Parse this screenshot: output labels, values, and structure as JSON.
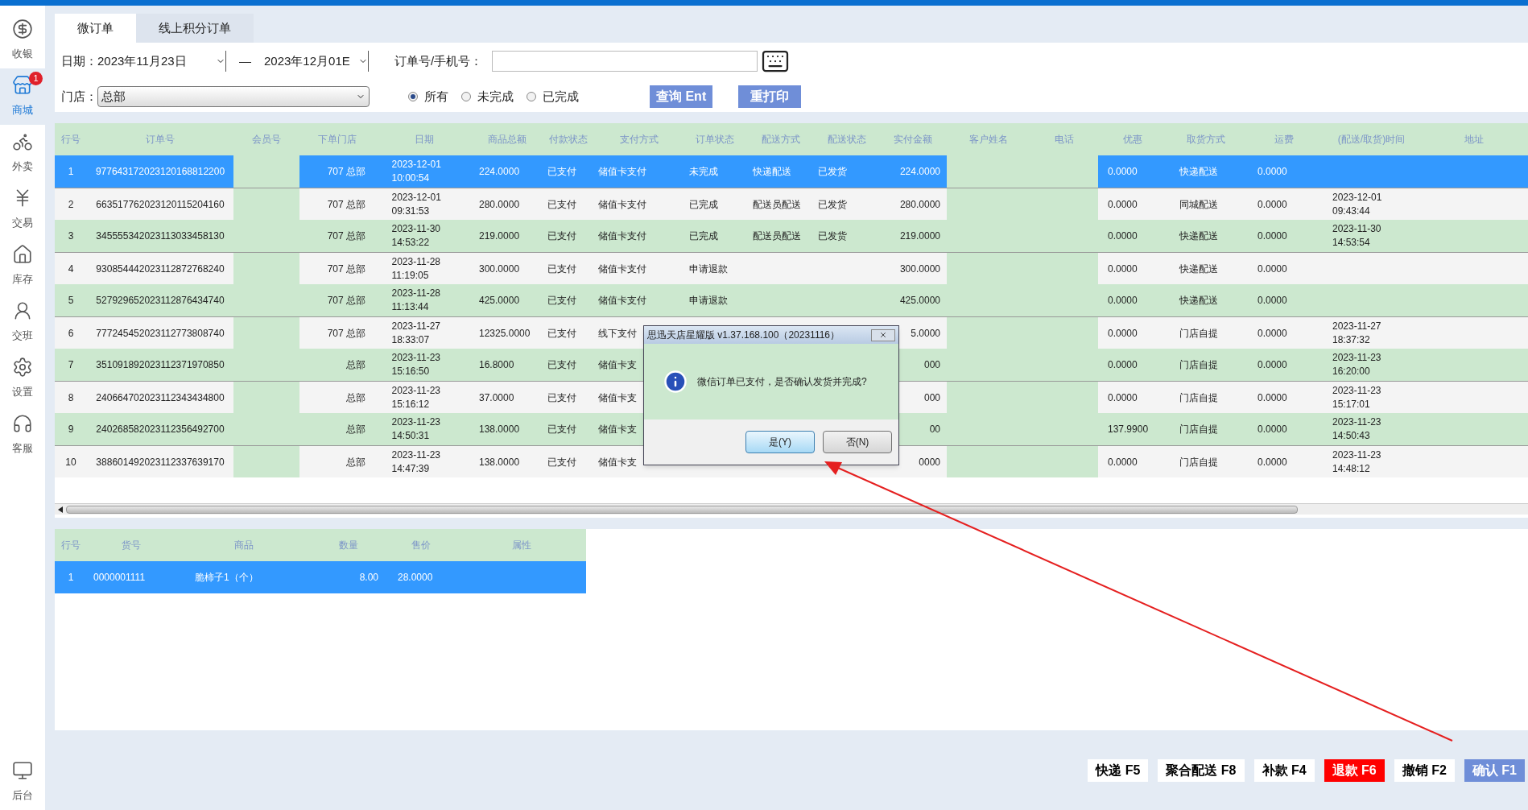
{
  "sidebar": {
    "items": [
      {
        "label": "收银",
        "selected": false
      },
      {
        "label": "商城",
        "selected": true,
        "badge": "1"
      },
      {
        "label": "外卖",
        "selected": false
      },
      {
        "label": "交易",
        "selected": false
      },
      {
        "label": "库存",
        "selected": false
      },
      {
        "label": "交班",
        "selected": false
      },
      {
        "label": "设置",
        "selected": false
      },
      {
        "label": "客服",
        "selected": false
      },
      {
        "label": "后台",
        "selected": false
      }
    ]
  },
  "tabs": [
    {
      "label": "微订单",
      "selected": true
    },
    {
      "label": "线上积分订单",
      "selected": false
    }
  ],
  "filters": {
    "date_label": "日期：",
    "date_from": "2023年11月23日",
    "separator": "—",
    "date_to": "2023年12月01E",
    "order_label": "订单号/手机号：",
    "store_label": "门店：",
    "store": "总部",
    "status_options": [
      {
        "label": "所有",
        "selected": true
      },
      {
        "label": "未完成",
        "selected": false
      },
      {
        "label": "已完成",
        "selected": false
      }
    ],
    "buttons": [
      "查询 Ent",
      "重打印"
    ]
  },
  "orders": {
    "columns": [
      "行号",
      "订单号",
      "会员号",
      "下单门店",
      "日期",
      "商品总额",
      "付款状态",
      "支付方式",
      "订单状态",
      "配送方式",
      "配送状态",
      "实付金额",
      "客户姓名",
      "电话",
      "优惠",
      "取货方式",
      "运费",
      "(配送/取货)时间",
      "地址"
    ],
    "rows": [
      {
        "selected": true,
        "row_no": "1",
        "order_no": "977643172023120168812200",
        "store": "707 总部",
        "date": "2023-12-01 10:00:54",
        "goods_total": "224.0000",
        "pay_status": "已支付",
        "pay_method": "储值卡支付",
        "order_status": "未完成",
        "delivery_method": "快递配送",
        "delivery_status": "已发货",
        "paid_amount": "224.0000",
        "discount": "0.0000",
        "pickup_method": "快递配送",
        "freight": "0.0000"
      },
      {
        "selected": false,
        "row_no": "2",
        "order_no": "663517762023120115204160",
        "store": "707 总部",
        "date": "2023-12-01 09:31:53",
        "goods_total": "280.0000",
        "pay_status": "已支付",
        "pay_method": "储值卡支付",
        "order_status": "已完成",
        "delivery_method": "配送员配送",
        "delivery_status": "已发货",
        "paid_amount": "280.0000",
        "discount": "0.0000",
        "pickup_method": "同城配送",
        "freight": "0.0000",
        "time": "2023-12-01 09:43:44"
      },
      {
        "selected": false,
        "row_no": "3",
        "order_no": "345555342023113033458130",
        "store": "707 总部",
        "date": "2023-11-30 14:53:22",
        "goods_total": "219.0000",
        "pay_status": "已支付",
        "pay_method": "储值卡支付",
        "order_status": "已完成",
        "delivery_method": "配送员配送",
        "delivery_status": "已发货",
        "paid_amount": "219.0000",
        "discount": "0.0000",
        "pickup_method": "快递配送",
        "freight": "0.0000",
        "time": "2023-11-30 14:53:54"
      },
      {
        "selected": false,
        "row_no": "4",
        "order_no": "930854442023112872768240",
        "store": "707 总部",
        "date": "2023-11-28 11:19:05",
        "goods_total": "300.0000",
        "pay_status": "已支付",
        "pay_method": "储值卡支付",
        "order_status": "申请退款",
        "paid_amount": "300.0000",
        "discount": "0.0000",
        "pickup_method": "快递配送",
        "freight": "0.0000"
      },
      {
        "selected": false,
        "row_no": "5",
        "order_no": "527929652023112876434740",
        "store": "707 总部",
        "date": "2023-11-28 11:13:44",
        "goods_total": "425.0000",
        "pay_status": "已支付",
        "pay_method": "储值卡支付",
        "order_status": "申请退款",
        "paid_amount": "425.0000",
        "discount": "0.0000",
        "pickup_method": "快递配送",
        "freight": "0.0000"
      },
      {
        "selected": false,
        "row_no": "6",
        "order_no": "777245452023112773808740",
        "store": "707 总部",
        "date": "2023-11-27 18:33:07",
        "goods_total": "12325.0000",
        "pay_status": "已支付",
        "pay_method": "线下支付",
        "paid_amount": "5.0000",
        "discount": "0.0000",
        "pickup_method": "门店自提",
        "freight": "0.0000",
        "time": "2023-11-27 18:37:32"
      },
      {
        "selected": false,
        "row_no": "7",
        "order_no": "351091892023112371970850",
        "store": "总部",
        "date": "2023-11-23 15:16:50",
        "goods_total": "16.8000",
        "pay_status": "已支付",
        "pay_method": "储值卡支",
        "paid_amount": "000",
        "discount": "0.0000",
        "pickup_method": "门店自提",
        "freight": "0.0000",
        "time": "2023-11-23 16:20:00"
      },
      {
        "selected": false,
        "row_no": "8",
        "order_no": "240664702023112343434800",
        "store": "总部",
        "date": "2023-11-23 15:16:12",
        "goods_total": "37.0000",
        "pay_status": "已支付",
        "pay_method": "储值卡支",
        "paid_amount": "000",
        "discount": "0.0000",
        "pickup_method": "门店自提",
        "freight": "0.0000",
        "time": "2023-11-23 15:17:01"
      },
      {
        "selected": false,
        "row_no": "9",
        "order_no": "240268582023112356492700",
        "store": "总部",
        "date": "2023-11-23 14:50:31",
        "goods_total": "138.0000",
        "pay_status": "已支付",
        "pay_method": "储值卡支",
        "paid_amount": "00",
        "discount": "137.9900",
        "pickup_method": "门店自提",
        "freight": "0.0000",
        "time": "2023-11-23 14:50:43"
      },
      {
        "selected": false,
        "row_no": "10",
        "order_no": "388601492023112337639170",
        "store": "总部",
        "date": "2023-11-23 14:47:39",
        "goods_total": "138.0000",
        "pay_status": "已支付",
        "pay_method": "储值卡支",
        "paid_amount": "0000",
        "discount": "0.0000",
        "pickup_method": "门店自提",
        "freight": "0.0000",
        "time": "2023-11-23 14:48:12"
      }
    ]
  },
  "items": {
    "columns": [
      "行号",
      "货号",
      "商品",
      "数量",
      "售价",
      "属性"
    ],
    "rows": [
      {
        "selected": true,
        "row_no": "1",
        "code": "0000001111",
        "name": "脆柿子1（个）",
        "qty": "8.00",
        "price": "28.0000"
      }
    ]
  },
  "dialog": {
    "title": "思迅天店星耀版 v1.37.168.100（20231116）",
    "message": "微信订单已支付，是否确认发货并完成?",
    "buttons": [
      {
        "label": "是(Y)",
        "selected": true
      },
      {
        "label": "否(N)",
        "selected": false
      }
    ]
  },
  "actions": [
    {
      "label": "快递 F5",
      "kind": "normal"
    },
    {
      "label": "聚合配送 F8",
      "kind": "normal"
    },
    {
      "label": "补款 F4",
      "kind": "normal"
    },
    {
      "label": "退款 F6",
      "kind": "danger"
    },
    {
      "label": "撤销 F2",
      "kind": "normal"
    },
    {
      "label": "确认 F1",
      "kind": "primary"
    }
  ]
}
